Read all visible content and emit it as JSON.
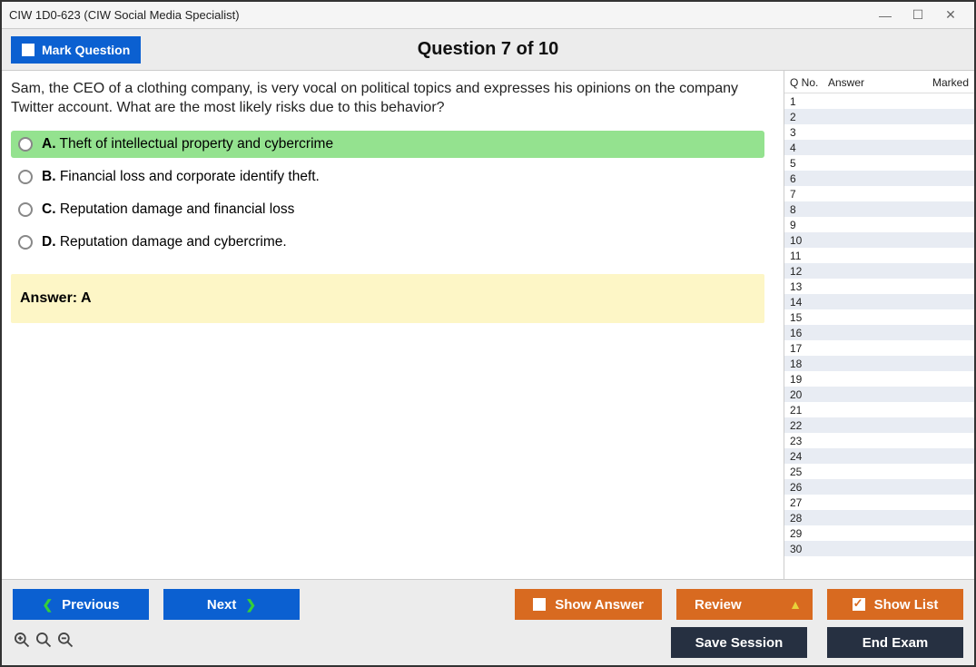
{
  "titlebar": {
    "title": "CIW 1D0-623 (CIW Social Media Specialist)"
  },
  "header": {
    "mark_label": "Mark Question",
    "question_indicator": "Question 7 of 10"
  },
  "question": {
    "text": "Sam, the CEO of a clothing company, is very vocal on political topics and expresses his opinions on the company Twitter account. What are the most likely risks due to this behavior?",
    "options": [
      {
        "letter": "A.",
        "text": "Theft of intellectual property and cybercrime",
        "selected": true
      },
      {
        "letter": "B.",
        "text": "Financial loss and corporate identify theft.",
        "selected": false
      },
      {
        "letter": "C.",
        "text": "Reputation damage and financial loss",
        "selected": false
      },
      {
        "letter": "D.",
        "text": "Reputation damage and cybercrime.",
        "selected": false
      }
    ],
    "answer_label": "Answer: A"
  },
  "sidepanel": {
    "col_qno": "Q No.",
    "col_answer": "Answer",
    "col_marked": "Marked",
    "rows": [
      {
        "n": "1"
      },
      {
        "n": "2"
      },
      {
        "n": "3"
      },
      {
        "n": "4"
      },
      {
        "n": "5"
      },
      {
        "n": "6"
      },
      {
        "n": "7"
      },
      {
        "n": "8"
      },
      {
        "n": "9"
      },
      {
        "n": "10"
      },
      {
        "n": "11"
      },
      {
        "n": "12"
      },
      {
        "n": "13"
      },
      {
        "n": "14"
      },
      {
        "n": "15"
      },
      {
        "n": "16"
      },
      {
        "n": "17"
      },
      {
        "n": "18"
      },
      {
        "n": "19"
      },
      {
        "n": "20"
      },
      {
        "n": "21"
      },
      {
        "n": "22"
      },
      {
        "n": "23"
      },
      {
        "n": "24"
      },
      {
        "n": "25"
      },
      {
        "n": "26"
      },
      {
        "n": "27"
      },
      {
        "n": "28"
      },
      {
        "n": "29"
      },
      {
        "n": "30"
      }
    ]
  },
  "footer": {
    "previous": "Previous",
    "next": "Next",
    "show_answer": "Show Answer",
    "review": "Review",
    "show_list": "Show List",
    "save_session": "Save Session",
    "end_exam": "End Exam"
  }
}
